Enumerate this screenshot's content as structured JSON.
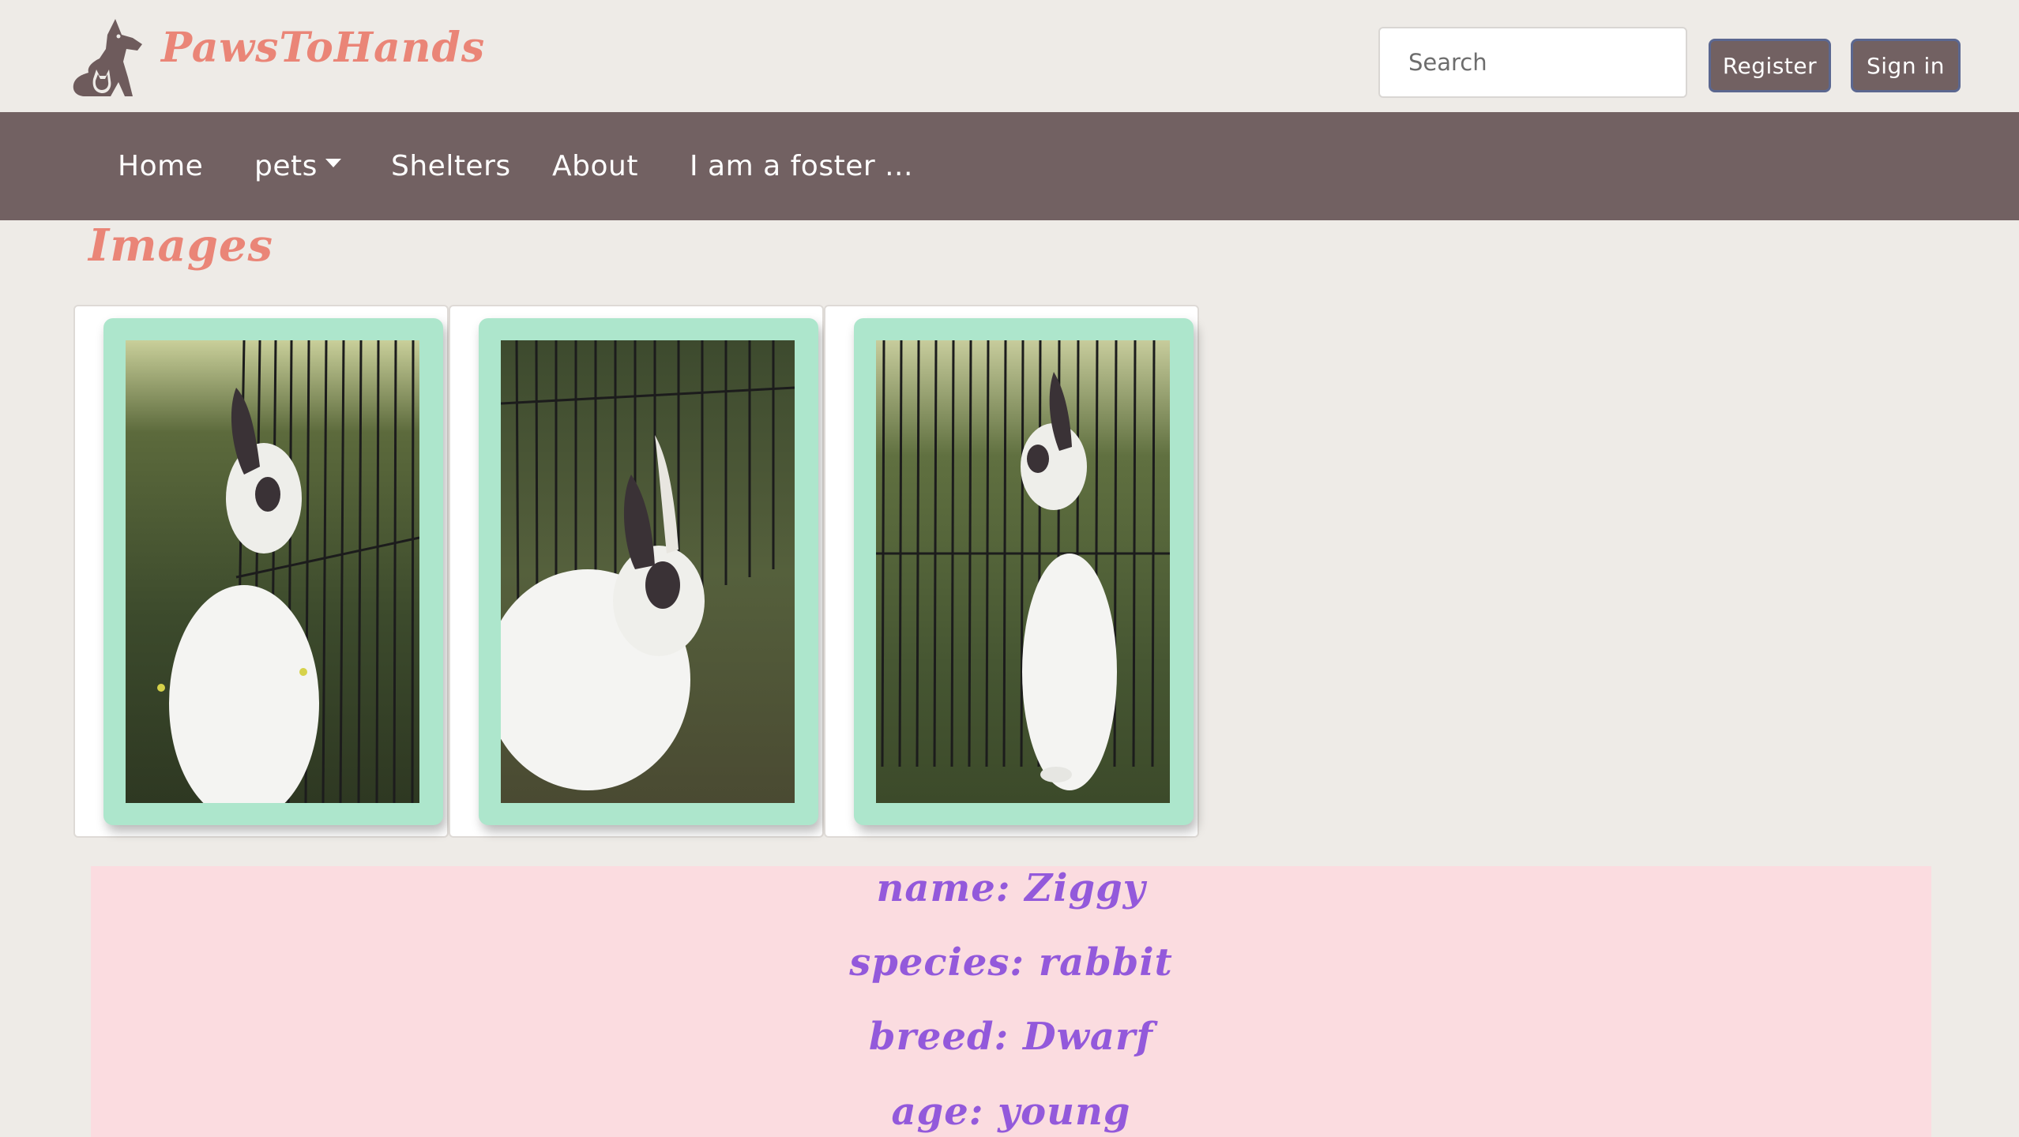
{
  "header": {
    "brand_name": "PawsToHands",
    "search_placeholder": "Search",
    "register_label": "Register",
    "signin_label": "Sign in"
  },
  "nav": {
    "items": [
      {
        "label": "Home"
      },
      {
        "label": "pets",
        "has_dropdown": true
      },
      {
        "label": "Shelters"
      },
      {
        "label": "About"
      },
      {
        "label": "I am a foster ..."
      }
    ]
  },
  "images_section": {
    "title": "Images",
    "photos": [
      {
        "icon": "rabbit-photo",
        "subject": "white rabbit facing fence, rear view"
      },
      {
        "icon": "rabbit-photo",
        "subject": "white rabbit sitting on grass, side view"
      },
      {
        "icon": "rabbit-photo",
        "subject": "white rabbit standing on hind legs at fence"
      }
    ]
  },
  "pet_info": {
    "name_line": "name: Ziggy",
    "species_line": "species: rabbit",
    "breed_line": "breed: Dwarf",
    "age_line": "age: young"
  },
  "colors": {
    "background": "#eeebe7",
    "brand": "#ea8577",
    "nav": "#726162",
    "frame": "#ade6cc",
    "info_panel": "#fbdce0",
    "info_text": "#9359db"
  }
}
